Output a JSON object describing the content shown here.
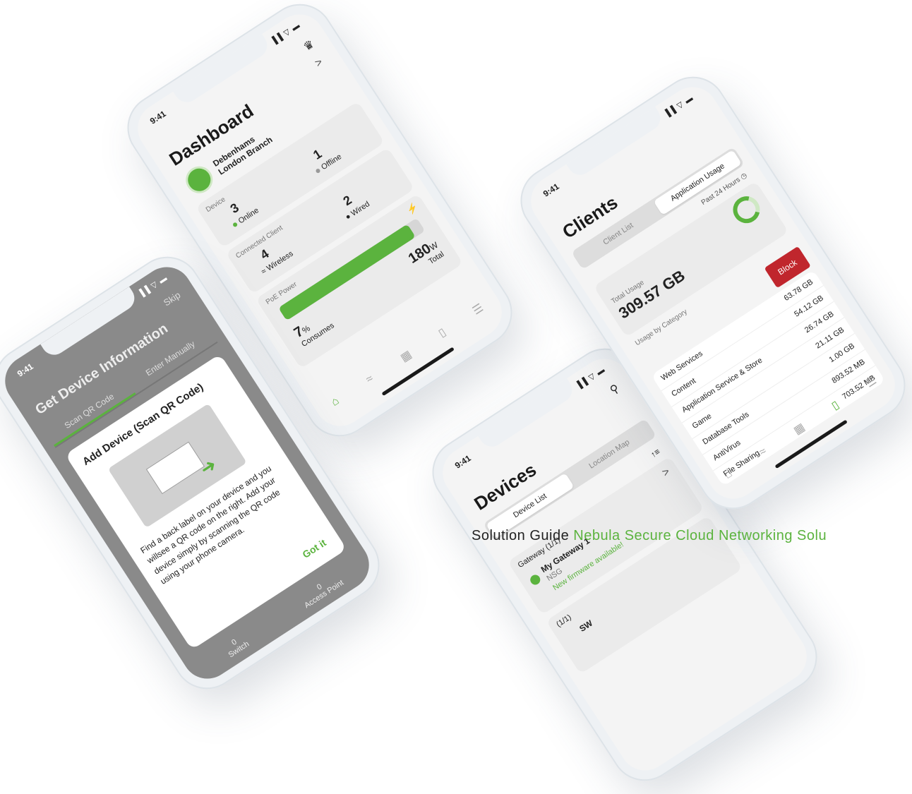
{
  "status": {
    "time": "9:41",
    "icons": "▐▐ ▽ ▬"
  },
  "dashboard": {
    "title": "Dashboard",
    "site_name": "Debenhams",
    "site_branch": "London Branch",
    "chevron": ">",
    "device_label": "Device",
    "online_count": "3",
    "online_label": "Online",
    "offline_count": "1",
    "offline_label": "Offline",
    "client_label": "Connected Client",
    "wireless_count": "4",
    "wireless_label": "Wireless",
    "wired_count": "2",
    "wired_label": "Wired",
    "poe_label": "PoE Power",
    "poe_total_value": "180",
    "poe_total_unit": "W",
    "poe_total_label": "Total",
    "poe_consumes_value": "7",
    "poe_consumes_unit": "%",
    "poe_consumes_label": "Consumes",
    "poe_fill_fraction": 0.93
  },
  "get_device": {
    "title": "Get Device Information",
    "skip": "Skip",
    "tab_scan": "Scan QR Code",
    "tab_manual": "Enter Manually",
    "modal_title": "Add Device (Scan QR Code)",
    "modal_body": "Find a back label on your device and you willsee a QR code on the right. Add your device simply by scanning the QR code using your phone camera.",
    "got_it": "Got it",
    "stat_switch_value": "0",
    "stat_switch_label": "Switch",
    "stat_ap_value": "0",
    "stat_ap_label": "Access Point"
  },
  "devices": {
    "title": "Devices",
    "tab_list": "Device List",
    "tab_map": "Location Map",
    "sort_icon": "↑≡",
    "group1": "Gateway (1/1)",
    "device1_name": "My Gateway 1",
    "device1_model": "NSG",
    "device1_note": "New firmware available!",
    "group2": "(1/1)",
    "device2_name": "SW",
    "chevron": ">"
  },
  "clients": {
    "title": "Clients",
    "tab_list": "Client List",
    "tab_app": "Application Usage",
    "period": "Past 24 Hours",
    "total_label": "Total Usage",
    "total_value": "309.57 GB",
    "by_category_label": "Usage by Category",
    "block_label": "Block",
    "content_label": "Content",
    "rows": [
      {
        "name": "Web Services",
        "value": "63.78 GB"
      },
      {
        "name": "",
        "value": "54.12 GB"
      },
      {
        "name": "Application Service & Store",
        "value": "26.74 GB"
      },
      {
        "name": "Game",
        "value": "21.11 GB"
      },
      {
        "name": "Database Tools",
        "value": "1.00 GB"
      },
      {
        "name": "AntiVirus",
        "value": "893.52 MB"
      },
      {
        "name": "File Sharing",
        "value": "703.52 MB"
      }
    ]
  },
  "footer": {
    "label": "Solution Guide",
    "subtitle": "Nebula Secure Cloud Networking Solu"
  },
  "colors": {
    "accent": "#5bb33e",
    "block": "#c0262d"
  }
}
